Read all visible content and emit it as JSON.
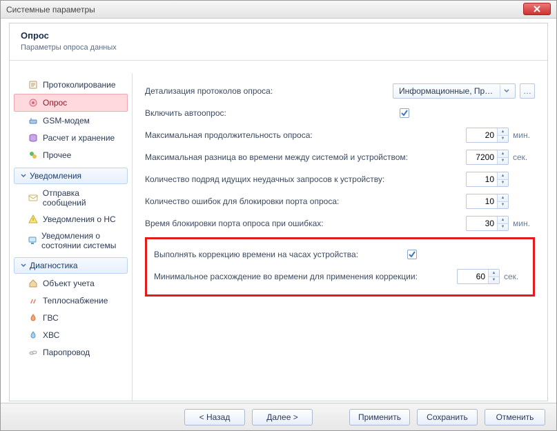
{
  "window": {
    "title": "Системные параметры"
  },
  "header": {
    "title": "Опрос",
    "subtitle": "Параметры опроса данных"
  },
  "sidebar": {
    "items": [
      {
        "label": "Протоколирование"
      },
      {
        "label": "Опрос"
      },
      {
        "label": "GSM-модем"
      },
      {
        "label": "Расчет и хранение"
      },
      {
        "label": "Прочее"
      }
    ],
    "groups": [
      {
        "label": "Уведомления",
        "items": [
          {
            "label": "Отправка сообщений"
          },
          {
            "label": "Уведомления о НС"
          },
          {
            "label": "Уведомления о состоянии системы"
          }
        ]
      },
      {
        "label": "Диагностика",
        "items": [
          {
            "label": "Объект учета"
          },
          {
            "label": "Теплоснабжение"
          },
          {
            "label": "ГВС"
          },
          {
            "label": "ХВС"
          },
          {
            "label": "Паропровод"
          }
        ]
      }
    ]
  },
  "settings": {
    "rows": [
      {
        "label": "Детализация протоколов опроса:",
        "type": "combo",
        "value": "Информационные, Пред..."
      },
      {
        "label": "Включить автоопрос:",
        "type": "check",
        "checked": true
      },
      {
        "label": "Максимальная продолжительность опроса:",
        "type": "spin",
        "value": "20",
        "unit": "мин."
      },
      {
        "label": "Максимальная разница во времени между системой и устройством:",
        "type": "spin",
        "value": "7200",
        "unit": "сек."
      },
      {
        "label": "Количество подряд идущих неудачных запросов к устройству:",
        "type": "spin",
        "value": "10",
        "unit": ""
      },
      {
        "label": "Количество ошибок для блокировки порта опроса:",
        "type": "spin",
        "value": "10",
        "unit": ""
      },
      {
        "label": "Время блокировки порта опроса при ошибках:",
        "type": "spin",
        "value": "30",
        "unit": "мин."
      }
    ],
    "highlight": [
      {
        "label": "Выполнять коррекцию времени на часах устройства:",
        "type": "check",
        "checked": true
      },
      {
        "label": "Минимальное расхождение во времени для применения коррекции:",
        "type": "spin",
        "value": "60",
        "unit": "сек."
      }
    ]
  },
  "buttons": {
    "back": "< Назад",
    "next": "Далее >",
    "apply": "Применить",
    "save": "Сохранить",
    "cancel": "Отменить"
  }
}
